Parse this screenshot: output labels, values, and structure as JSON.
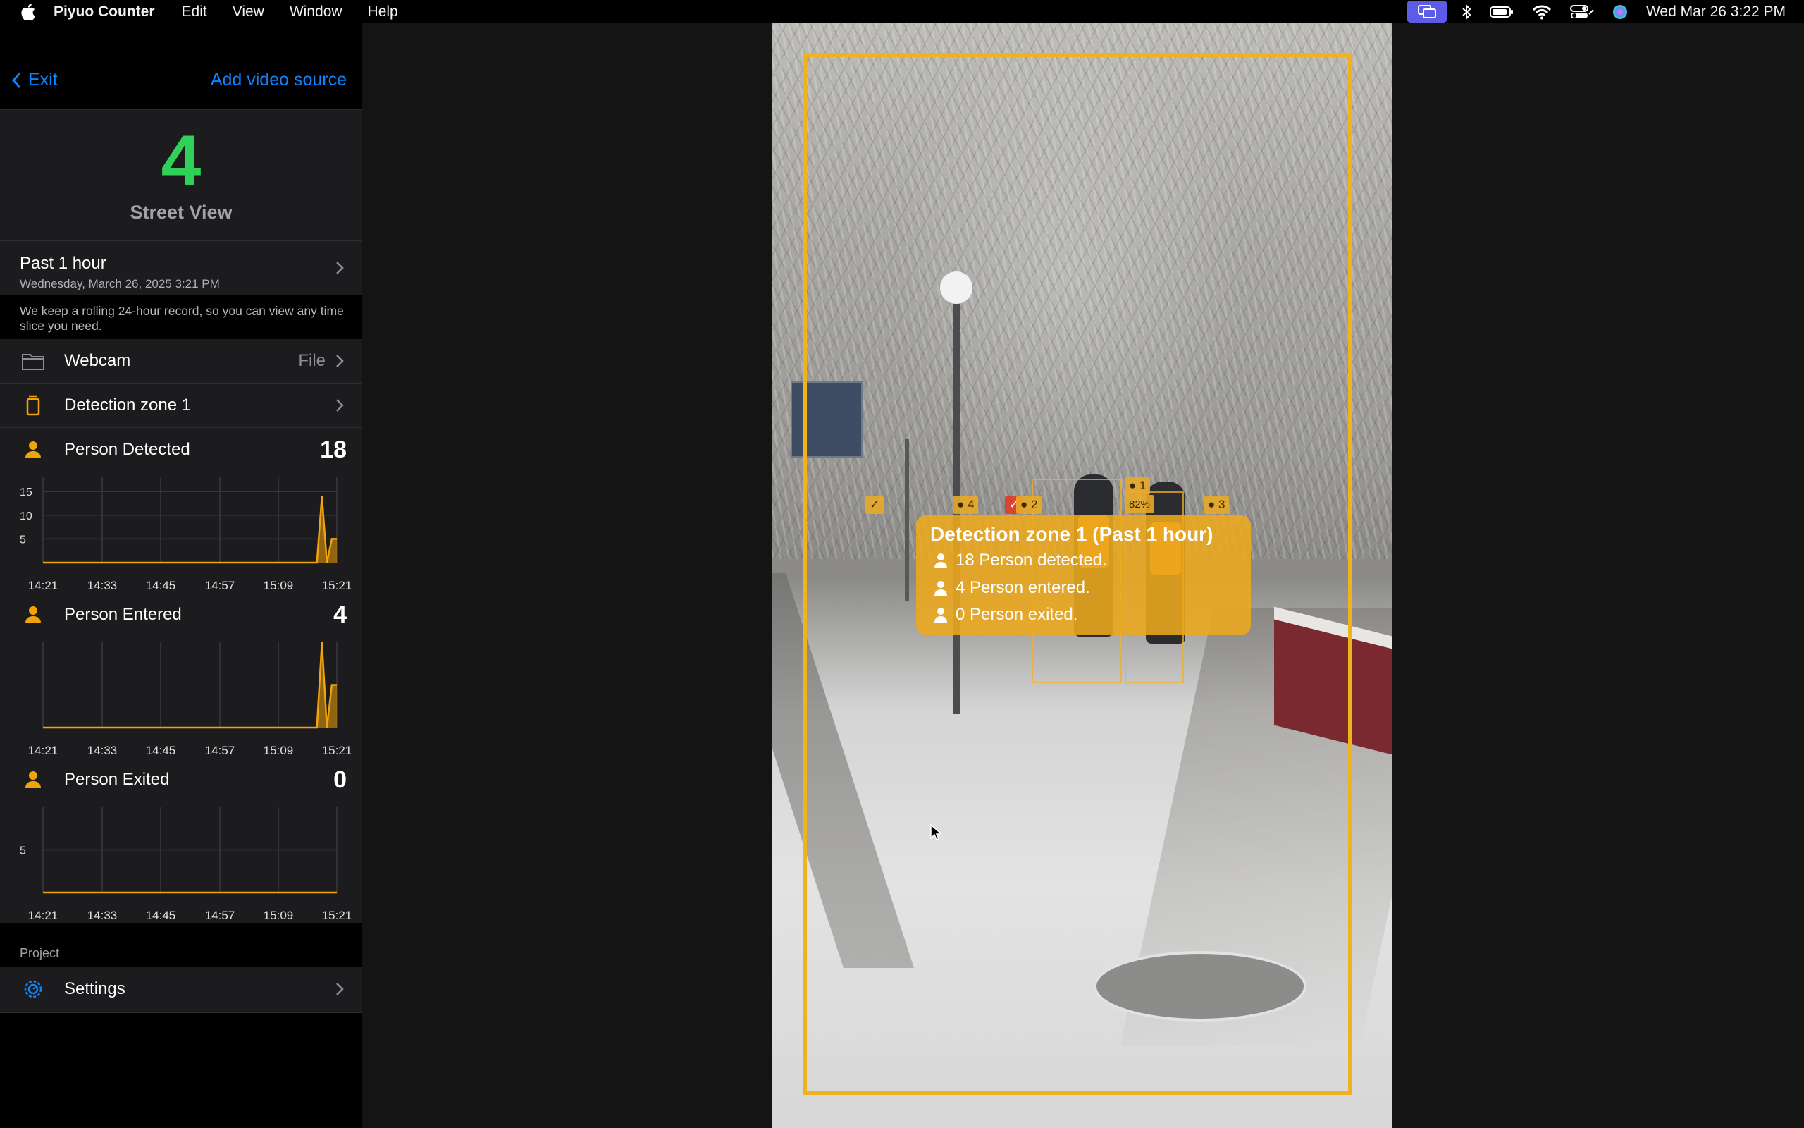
{
  "menubar": {
    "app_name": "Piyuo Counter",
    "menus": [
      "Edit",
      "View",
      "Window",
      "Help"
    ],
    "clock": "Wed Mar 26  3:22 PM"
  },
  "sidebar": {
    "exit_label": "Exit",
    "add_source_label": "Add video source",
    "hero": {
      "count": "4",
      "name": "Street View"
    },
    "period": {
      "title": "Past 1 hour",
      "date": "Wednesday, March 26, 2025 3:21 PM",
      "note": "We keep a rolling 24-hour record, so you can view any time slice you need."
    },
    "source": {
      "label": "Webcam",
      "type": "File"
    },
    "zone": {
      "label": "Detection zone 1"
    },
    "metrics": [
      {
        "label": "Person Detected",
        "value": "18"
      },
      {
        "label": "Person Entered",
        "value": "4"
      },
      {
        "label": "Person Exited",
        "value": "0"
      }
    ],
    "project_label": "Project",
    "settings_label": "Settings"
  },
  "chart_data": [
    {
      "type": "area",
      "title": "Person Detected",
      "x": [
        "14:21",
        "14:33",
        "14:45",
        "14:57",
        "15:09",
        "15:21"
      ],
      "yticks": [
        "5",
        "10",
        "15"
      ],
      "ylim": [
        0,
        18
      ],
      "values": [
        0,
        0,
        0,
        0,
        0,
        0,
        0,
        0,
        0,
        0,
        0,
        0,
        0,
        0,
        0,
        0,
        0,
        0,
        0,
        0,
        0,
        0,
        0,
        0,
        0,
        0,
        0,
        0,
        0,
        0,
        0,
        0,
        0,
        0,
        0,
        0,
        0,
        0,
        0,
        0,
        0,
        0,
        0,
        0,
        0,
        0,
        0,
        0,
        0,
        0,
        0,
        0,
        0,
        0,
        0,
        0,
        14,
        0,
        5,
        5
      ],
      "color": "#f0a30a",
      "grid": true
    },
    {
      "type": "area",
      "title": "Person Entered",
      "x": [
        "14:21",
        "14:33",
        "14:45",
        "14:57",
        "15:09",
        "15:21"
      ],
      "yticks": [],
      "ylim": [
        0,
        4
      ],
      "values": [
        0,
        0,
        0,
        0,
        0,
        0,
        0,
        0,
        0,
        0,
        0,
        0,
        0,
        0,
        0,
        0,
        0,
        0,
        0,
        0,
        0,
        0,
        0,
        0,
        0,
        0,
        0,
        0,
        0,
        0,
        0,
        0,
        0,
        0,
        0,
        0,
        0,
        0,
        0,
        0,
        0,
        0,
        0,
        0,
        0,
        0,
        0,
        0,
        0,
        0,
        0,
        0,
        0,
        0,
        0,
        0,
        4,
        0,
        2,
        2
      ],
      "color": "#f0a30a",
      "grid": true
    },
    {
      "type": "area",
      "title": "Person Exited",
      "x": [
        "14:21",
        "14:33",
        "14:45",
        "14:57",
        "15:09",
        "15:21"
      ],
      "yticks": [
        "5"
      ],
      "ylim": [
        0,
        10
      ],
      "values": [
        0,
        0,
        0,
        0,
        0,
        0,
        0,
        0,
        0,
        0,
        0,
        0,
        0,
        0,
        0,
        0,
        0,
        0,
        0,
        0,
        0,
        0,
        0,
        0,
        0,
        0,
        0,
        0,
        0,
        0,
        0,
        0,
        0,
        0,
        0,
        0,
        0,
        0,
        0,
        0,
        0,
        0,
        0,
        0,
        0,
        0,
        0,
        0,
        0,
        0,
        0,
        0,
        0,
        0,
        0,
        0,
        0,
        0,
        0,
        0
      ],
      "color": "#f0a30a",
      "grid": true
    }
  ],
  "video": {
    "overlay": {
      "title": "Detection zone 1 (Past 1 hour)",
      "lines": [
        "18 Person detected.",
        "4 Person entered.",
        "0 Person exited."
      ]
    },
    "track_tags": [
      "4",
      "2",
      "1",
      "3",
      "82%"
    ],
    "colors": {
      "zone": "#f0b31e",
      "overlay": "#eca81c"
    }
  },
  "colors": {
    "accent_blue": "#0a84ff",
    "count_green": "#30d158",
    "chart_orange": "#f0a30a"
  }
}
